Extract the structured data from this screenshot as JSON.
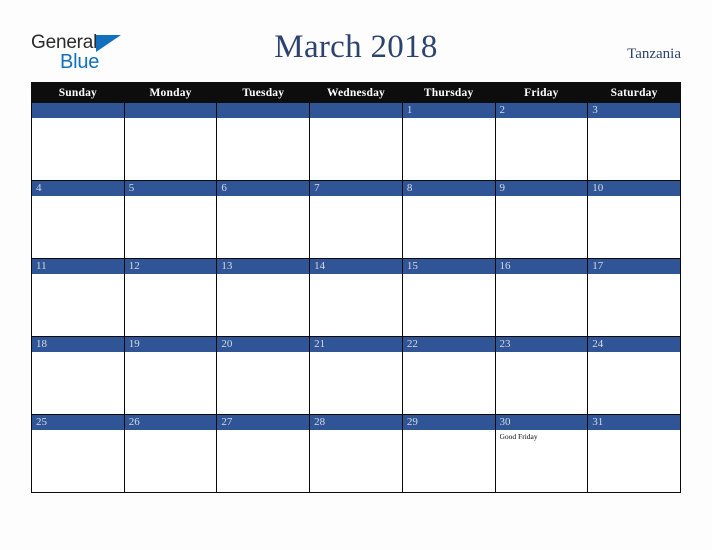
{
  "branding": {
    "logo_word_1": "General",
    "logo_word_2": "Blue",
    "logo_icon": "blue-triangle-icon",
    "logo_color_dark": "#2b2b2b",
    "logo_color_blue": "#1271bf"
  },
  "header": {
    "title": "March 2018",
    "country": "Tanzania",
    "title_color": "#2c4370"
  },
  "calendar": {
    "month": "March",
    "year": "2018",
    "header_bg": "#0d0d0d",
    "daybar_bg": "#2f5597",
    "daynum_color": "#d7dae2",
    "day_headers": [
      "Sunday",
      "Monday",
      "Tuesday",
      "Wednesday",
      "Thursday",
      "Friday",
      "Saturday"
    ],
    "weeks": [
      [
        {
          "date": "",
          "events": []
        },
        {
          "date": "",
          "events": []
        },
        {
          "date": "",
          "events": []
        },
        {
          "date": "",
          "events": []
        },
        {
          "date": "1",
          "events": []
        },
        {
          "date": "2",
          "events": []
        },
        {
          "date": "3",
          "events": []
        }
      ],
      [
        {
          "date": "4",
          "events": []
        },
        {
          "date": "5",
          "events": []
        },
        {
          "date": "6",
          "events": []
        },
        {
          "date": "7",
          "events": []
        },
        {
          "date": "8",
          "events": []
        },
        {
          "date": "9",
          "events": []
        },
        {
          "date": "10",
          "events": []
        }
      ],
      [
        {
          "date": "11",
          "events": []
        },
        {
          "date": "12",
          "events": []
        },
        {
          "date": "13",
          "events": []
        },
        {
          "date": "14",
          "events": []
        },
        {
          "date": "15",
          "events": []
        },
        {
          "date": "16",
          "events": []
        },
        {
          "date": "17",
          "events": []
        }
      ],
      [
        {
          "date": "18",
          "events": []
        },
        {
          "date": "19",
          "events": []
        },
        {
          "date": "20",
          "events": []
        },
        {
          "date": "21",
          "events": []
        },
        {
          "date": "22",
          "events": []
        },
        {
          "date": "23",
          "events": []
        },
        {
          "date": "24",
          "events": []
        }
      ],
      [
        {
          "date": "25",
          "events": []
        },
        {
          "date": "26",
          "events": []
        },
        {
          "date": "27",
          "events": []
        },
        {
          "date": "28",
          "events": []
        },
        {
          "date": "29",
          "events": []
        },
        {
          "date": "30",
          "events": [
            "Good Friday"
          ]
        },
        {
          "date": "31",
          "events": []
        }
      ]
    ]
  }
}
